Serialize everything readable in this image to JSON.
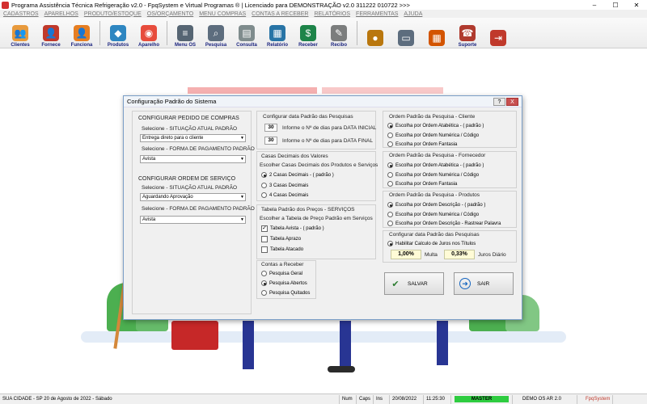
{
  "window": {
    "title": "Programa Assistência Técnica Refrigeração v2.0 - FpqSystem e Virtual Programas ® | Licenciado para  DEMONSTRAÇÃO v2.0 311222 010722 >>>"
  },
  "menu": [
    "CADASTROS",
    "APARELHOS",
    "PRODUTO/ESTOQUE",
    "OS/ORÇAMENTO",
    "MENU COMPRAS",
    "CONTAS A RECEBER",
    "RELATÓRIOS",
    "FERRAMENTAS",
    "AJUDA"
  ],
  "toolbar": [
    {
      "label": "Clientes",
      "icon": "people-icon",
      "color": "#e89a3c",
      "glyph": "👥"
    },
    {
      "label": "Fornece",
      "icon": "supplier-icon",
      "color": "#c0392b",
      "glyph": "👤"
    },
    {
      "label": "Funciona",
      "icon": "employee-icon",
      "color": "#e67e22",
      "glyph": "👤"
    },
    {
      "label": "Produtos",
      "icon": "products-icon",
      "color": "#2e86c1",
      "glyph": "◆"
    },
    {
      "label": "Aparelho",
      "icon": "device-icon",
      "color": "#e74c3c",
      "glyph": "◉"
    },
    {
      "label": "Menu OS",
      "icon": "document-icon",
      "color": "#566573",
      "glyph": "≡"
    },
    {
      "label": "Pesquisa",
      "icon": "search-icon",
      "color": "#5d6d7e",
      "glyph": "⌕"
    },
    {
      "label": "Consulta",
      "icon": "consult-icon",
      "color": "#7f8c8d",
      "glyph": "▤"
    },
    {
      "label": "Relatório",
      "icon": "report-icon",
      "color": "#2874a6",
      "glyph": "▦"
    },
    {
      "label": "Receber",
      "icon": "money-icon",
      "color": "#1e8449",
      "glyph": "$"
    },
    {
      "label": "Recibo",
      "icon": "receipt-icon",
      "color": "#7b7d7d",
      "glyph": "✎"
    },
    {
      "label": "",
      "icon": "coin-icon",
      "color": "#b9770e",
      "glyph": "●"
    },
    {
      "label": "",
      "icon": "notepad-icon",
      "color": "#5d6d7e",
      "glyph": "▭"
    },
    {
      "label": "",
      "icon": "calculator-icon",
      "color": "#d35400",
      "glyph": "▦"
    },
    {
      "label": "Suporte",
      "icon": "support-icon",
      "color": "#b03a2e",
      "glyph": "☎"
    },
    {
      "label": "",
      "icon": "exit-icon",
      "color": "#c0392b",
      "glyph": "⇥"
    }
  ],
  "dialog": {
    "title": "Configuração Padrão do Sistema",
    "help_glyph": "?",
    "close_glyph": "X",
    "compras": {
      "header": "CONFIGURAR PEDIDO DE COMPRAS",
      "situacao_label": "Selecione - SITUAÇÃO ATUAL PADRÃO",
      "situacao_value": "Entrega direto para o cliente",
      "pagamento_label": "Selecione - FORMA DE PAGAMENTO PADRÃO",
      "pagamento_value": "Avista"
    },
    "os": {
      "header": "CONFIGURAR ORDEM DE SERVIÇO",
      "situacao_label": "Selecione - SITUAÇÃO ATUAL PADRÃO",
      "situacao_value": "Aguardando Aprovação",
      "pagamento_label": "Selecione - FORMA DE PAGAMENTO PADRÃO",
      "pagamento_value": "Avista"
    },
    "dias": {
      "header": "Configurar data Padrão das Pesquisas",
      "inicial_value": "30",
      "inicial_label": "Informe o Nº de dias para DATA INICIAL",
      "final_value": "30",
      "final_label": "Informe o Nº de dias para DATA FINAL"
    },
    "decimais": {
      "header": "Casas Decimais dos Valores",
      "subheader": "Escolher Casas Decimais dos Produtos e Serviços",
      "options": [
        "2 Casas Decimais - ( padrão )",
        "3 Casas Decimais",
        "4 Casas Decimais"
      ],
      "selected": 0
    },
    "precos": {
      "header": "Tabela Padrão dos Preços - SERVIÇOS",
      "subheader": "Escolher a Tabela de Preço Padrão em Serviços",
      "options": [
        "Tabela Avista - ( padrão )",
        "Tabela Aprazo",
        "Tabela Atacado"
      ],
      "checked": [
        true,
        false,
        false
      ]
    },
    "contas": {
      "header": "Contas a Receber",
      "options": [
        "Pesquisa Geral",
        "Pesquisa Abertos",
        "Pesquisa Quitados"
      ],
      "selected": 1
    },
    "cliente": {
      "header": "Ordem Padrão da Pesquisa - Cliente",
      "options": [
        "Escolha por Ordem Atabética - ( padrão )",
        "Escolha por Ordem Numérica / Código",
        "Escolha por Ordem Fantasia"
      ],
      "selected": 0
    },
    "fornecedor": {
      "header": "Ordem Padrão da Pesquisa - Fornecedor",
      "options": [
        "Escolha por Ordem Atabética - ( padrão )",
        "Escolha por Ordem Numérica / Código",
        "Escolha por Ordem Fantasia"
      ],
      "selected": 0
    },
    "produtos": {
      "header": "Ordem Padrão da Pesquisa - Produtos",
      "options": [
        "Escolha por Ordem Descrição - ( padrão )",
        "Escolha por Ordem Numérica / Código",
        "Escolha por Ordem Descrição - Rastrear Palavra"
      ],
      "selected": 0
    },
    "juros": {
      "header": "Configurar data Padrão das Pesquisas",
      "enable_label": "Habilitar Calculo de Juros nos Títulos",
      "multa_value": "1,00%",
      "multa_label": "Multa",
      "juros_value": "0,33%",
      "juros_label": "Juros Diário"
    },
    "buttons": {
      "save": "SALVAR",
      "exit": "SAIR"
    }
  },
  "statusbar": {
    "location_date": "SUA CIDADE - SP 20 de Agosto de 2022 - Sábado",
    "num": "Num",
    "caps": "Caps",
    "ins": "Ins",
    "date": "20/08/2022",
    "time": "11:25:30",
    "user": "MASTER",
    "demo": "DEMO OS AR 2.0",
    "brand": "FpqSystem"
  }
}
